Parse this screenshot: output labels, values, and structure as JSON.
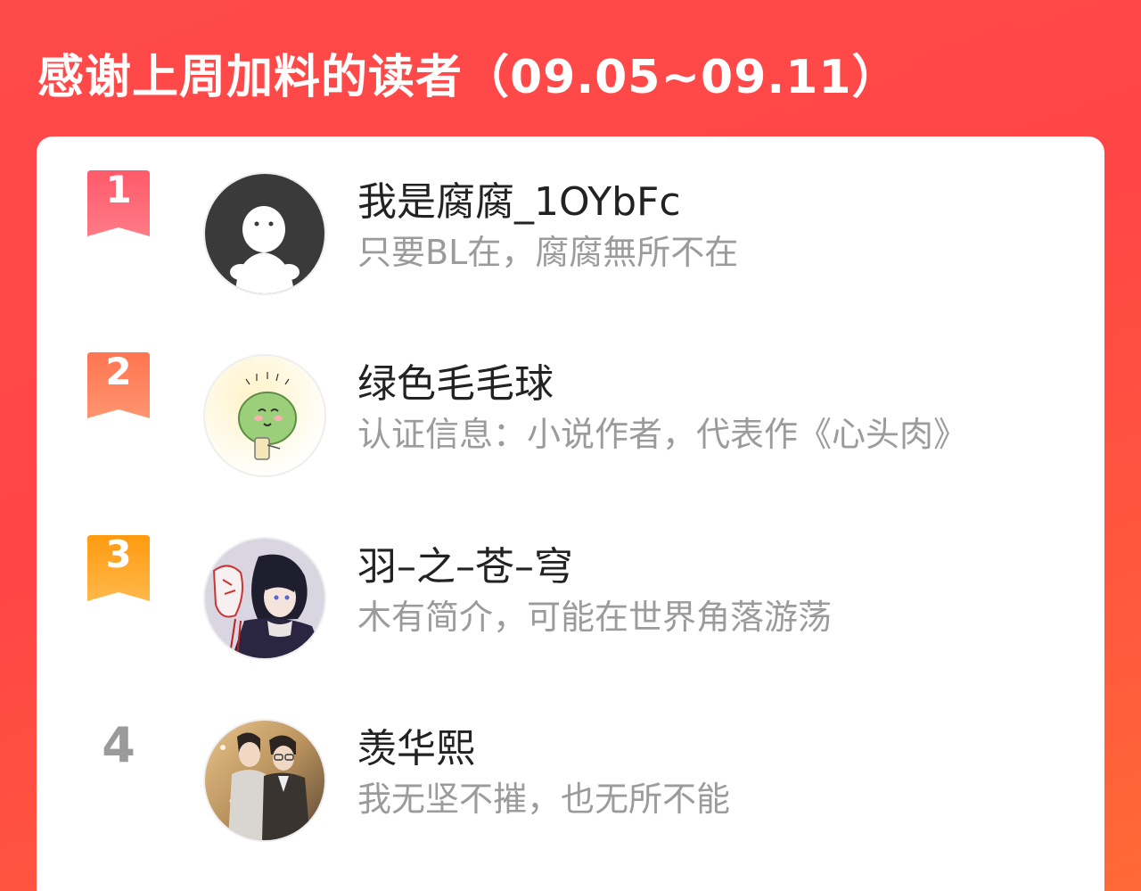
{
  "header": {
    "title": "感谢上周加料的读者（09.05~09.11）"
  },
  "colors": {
    "background": "#ff4848",
    "rank1": "#ff5a6a",
    "rank2": "#ff7f5a",
    "rank3": "#ffa21e",
    "rank_plain": "#9a9a9a"
  },
  "readers": [
    {
      "rank": "1",
      "name": "我是腐腐_1OYbFc",
      "bio": "只要BL在，腐腐無所不在",
      "avatar_icon": "default-ghost-avatar-icon"
    },
    {
      "rank": "2",
      "name": "绿色毛毛球",
      "bio": "认证信息：小说作者，代表作《心头肉》",
      "avatar_icon": "green-fuzzball-avatar-icon"
    },
    {
      "rank": "3",
      "name": "羽–之–苍–穹",
      "bio": "木有简介，可能在世界角落游荡",
      "avatar_icon": "anime-boy-mask-avatar-icon"
    },
    {
      "rank": "4",
      "name": "羡华熙",
      "bio": "我无坚不摧，也无所不能",
      "avatar_icon": "two-men-illustration-avatar-icon"
    }
  ]
}
